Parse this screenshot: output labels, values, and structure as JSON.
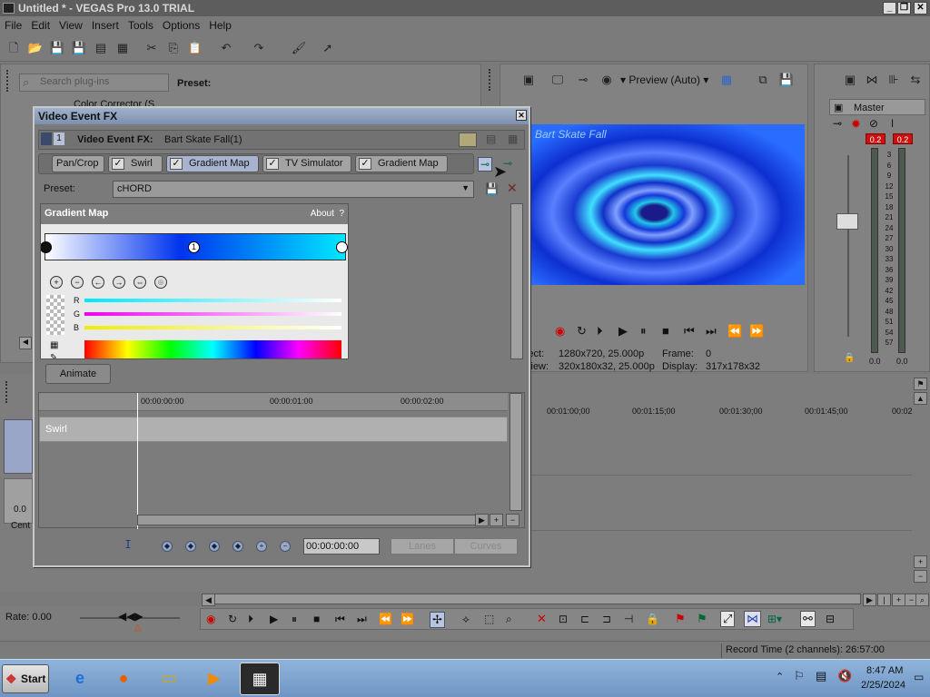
{
  "window": {
    "title": "Untitled * - VEGAS Pro 13.0 TRIAL"
  },
  "menu": [
    "File",
    "Edit",
    "View",
    "Insert",
    "Tools",
    "Options",
    "Help"
  ],
  "plugins": {
    "search_placeholder": "Search plug-ins",
    "item": "Color Corrector (S",
    "preset_label": "Preset:"
  },
  "preview": {
    "mode": "Preview (Auto)",
    "project": "ject:",
    "project_val": "1280x720, 25.000p",
    "preview_lbl": "view:",
    "preview_val": "320x180x32, 25.000p",
    "frame_lbl": "Frame:",
    "frame_val": "0",
    "display_lbl": "Display:",
    "display_val": "317x178x32",
    "overlay_text": "Bart Skate Fall"
  },
  "mixer": {
    "label": "Master",
    "peak_l": "0.2",
    "peak_r": "0.2",
    "scale": [
      "3",
      "6",
      "9",
      "12",
      "15",
      "18",
      "21",
      "24",
      "27",
      "30",
      "33",
      "36",
      "39",
      "42",
      "45",
      "48",
      "51",
      "54",
      "57"
    ],
    "bottom_l": "0.0",
    "bottom_r": "0.0"
  },
  "dialog": {
    "title": "Video Event FX",
    "track_no": "1",
    "fx_label": "Video Event FX:",
    "fx_name": "Bart Skate Fall(1)",
    "chain": [
      {
        "label": "Pan/Crop",
        "checked": false
      },
      {
        "label": "Swirl",
        "checked": true
      },
      {
        "label": "Gradient Map",
        "checked": true,
        "active": true
      },
      {
        "label": "TV Simulator",
        "checked": true
      },
      {
        "label": "Gradient Map",
        "checked": true
      }
    ],
    "preset_label": "Preset:",
    "preset_value": "cHORD",
    "panel_title": "Gradient Map",
    "about": "About",
    "about_q": "?",
    "stop_label": "1",
    "channels": [
      "R",
      "G",
      "B"
    ],
    "animate": "Animate",
    "timeline": {
      "t0": "00:00:00:00",
      "t1": "00:00:01:00",
      "t2": "00:00:02:00",
      "track": "Swirl"
    },
    "timecode": "00:00:00:00",
    "lanes": "Lanes",
    "curves": "Curves"
  },
  "timeline": {
    "ruler": [
      "00:01:00;00",
      "00:01:15;00",
      "00:01:30;00",
      "00:01:45;00",
      "00:02"
    ],
    "track_level": "0.0",
    "track_label": "Cent"
  },
  "transport": {
    "rate": "Rate: 0.00"
  },
  "status": {
    "record_time": "Record Time (2 channels): 26:57:00"
  },
  "taskbar": {
    "start": "Start",
    "time": "8:47 AM",
    "date": "2/25/2024"
  }
}
